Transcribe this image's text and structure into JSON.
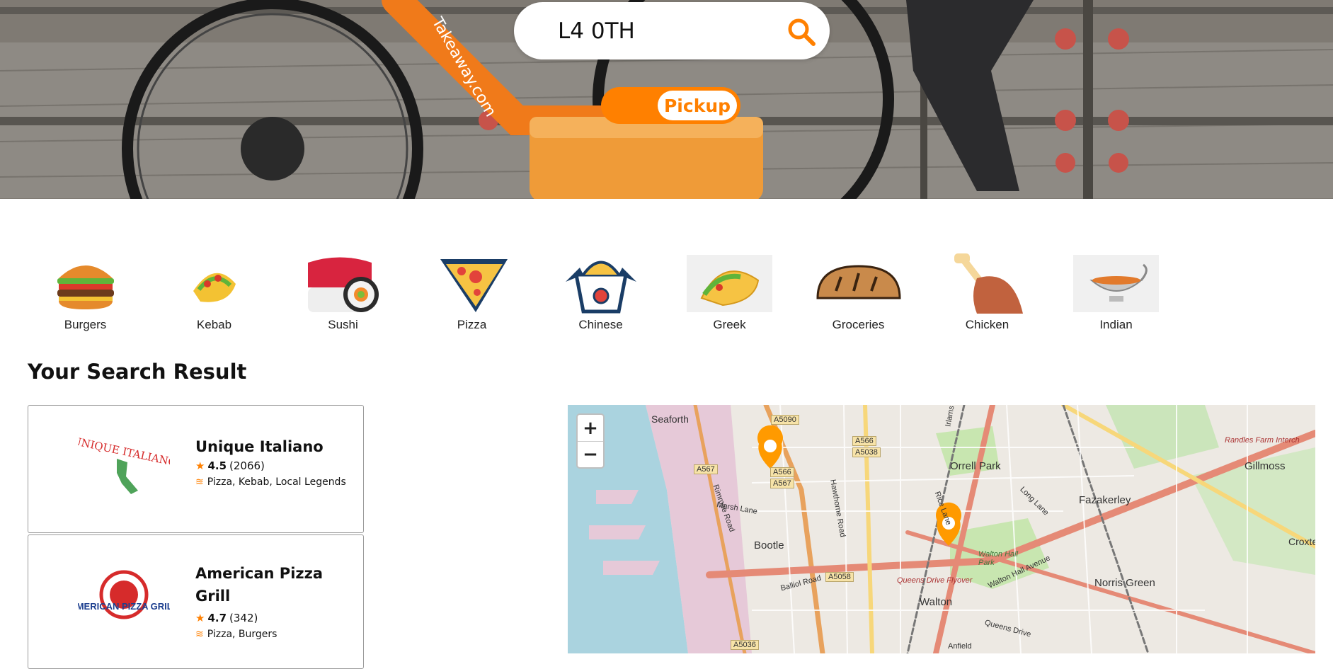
{
  "search": {
    "value": "L4 0TH"
  },
  "mode_toggle": {
    "selected": "Pickup"
  },
  "categories": [
    {
      "label": "Burgers",
      "icon": "burger-icon"
    },
    {
      "label": "Kebab",
      "icon": "kebab-icon"
    },
    {
      "label": "Sushi",
      "icon": "sushi-icon"
    },
    {
      "label": "Pizza",
      "icon": "pizza-icon"
    },
    {
      "label": "Chinese",
      "icon": "chinese-icon"
    },
    {
      "label": "Greek",
      "icon": "greek-icon"
    },
    {
      "label": "Groceries",
      "icon": "groceries-icon"
    },
    {
      "label": "Chicken",
      "icon": "chicken-icon"
    },
    {
      "label": "Indian",
      "icon": "indian-icon"
    }
  ],
  "results": {
    "title": "Your Search Result",
    "items": [
      {
        "name": "Unique Italiano",
        "rating": "4.5",
        "reviews": "(2066)",
        "cuisines": "Pizza, Kebab, Local Legends",
        "logo_text": "UNIQUE ITALIANO"
      },
      {
        "name": "American Pizza Grill",
        "rating": "4.7",
        "reviews": "(342)",
        "cuisines": "Pizza, Burgers",
        "logo_text": "AMERICAN PIZZA GRILL"
      }
    ]
  },
  "map": {
    "zoom_in": "+",
    "zoom_out": "−",
    "places": [
      "Seaforth",
      "Orrell Park",
      "Gillmoss",
      "Fazakerley",
      "Bootle",
      "Walton",
      "Norris Green",
      "Croxte",
      "Randles Farm Interch",
      "Walton Hall Park",
      "Queens Drive Flyover"
    ],
    "roads": [
      "A5090",
      "A566",
      "A5038",
      "A567",
      "A566",
      "A567",
      "A5058",
      "A5036"
    ],
    "streets": [
      "Marsh Lane",
      "Hawthorne Road",
      "Rimrose Road",
      "Long Lane",
      "Rice Lane",
      "Walton Hall Avenue",
      "Balliol Road",
      "Queens Drive",
      "Anfield",
      "Irlams"
    ]
  },
  "colors": {
    "accent": "#ff8000"
  }
}
